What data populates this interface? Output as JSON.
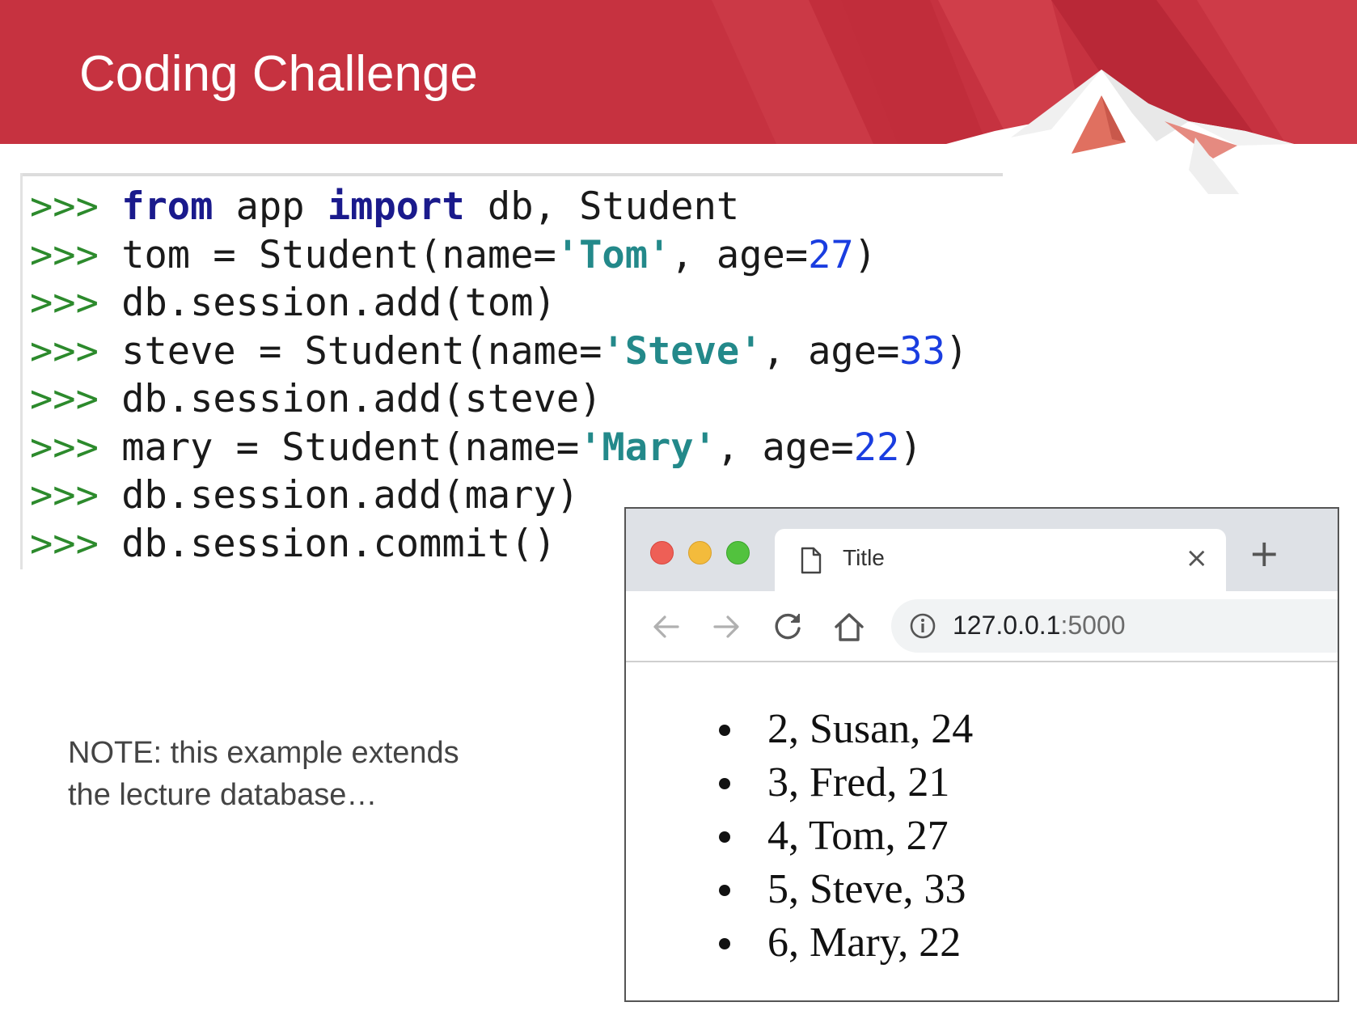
{
  "slide": {
    "title": "Coding Challenge",
    "colors": {
      "header_red": "#c63240",
      "header_dark": "#b0202e",
      "header_light": "#d4434f",
      "snow": "#ffffff"
    }
  },
  "code": {
    "prompt": ">>>",
    "lines": [
      {
        "segments": [
          {
            "t": "kw",
            "v": "from"
          },
          {
            "t": "plain",
            "v": " app "
          },
          {
            "t": "kw",
            "v": "import"
          },
          {
            "t": "plain",
            "v": " db, Student"
          }
        ]
      },
      {
        "segments": [
          {
            "t": "plain",
            "v": "tom = Student(name="
          },
          {
            "t": "str",
            "v": "'Tom'"
          },
          {
            "t": "plain",
            "v": ", age="
          },
          {
            "t": "num",
            "v": "27"
          },
          {
            "t": "plain",
            "v": ")"
          }
        ]
      },
      {
        "segments": [
          {
            "t": "plain",
            "v": "db.session.add(tom)"
          }
        ]
      },
      {
        "segments": [
          {
            "t": "plain",
            "v": "steve = Student(name="
          },
          {
            "t": "str",
            "v": "'Steve'"
          },
          {
            "t": "plain",
            "v": ", age="
          },
          {
            "t": "num",
            "v": "33"
          },
          {
            "t": "plain",
            "v": ")"
          }
        ]
      },
      {
        "segments": [
          {
            "t": "plain",
            "v": "db.session.add(steve)"
          }
        ]
      },
      {
        "segments": [
          {
            "t": "plain",
            "v": "mary = Student(name="
          },
          {
            "t": "str",
            "v": "'Mary'"
          },
          {
            "t": "plain",
            "v": ", age="
          },
          {
            "t": "num",
            "v": "22"
          },
          {
            "t": "plain",
            "v": ")"
          }
        ]
      },
      {
        "segments": [
          {
            "t": "plain",
            "v": "db.session.add(mary)"
          }
        ]
      },
      {
        "segments": [
          {
            "t": "plain",
            "v": "db.session.commit()"
          }
        ]
      }
    ]
  },
  "note": {
    "line1": "NOTE: this example extends",
    "line2": "the lecture database…"
  },
  "browser": {
    "tab": {
      "title": "Title",
      "icon": "document-icon",
      "close_symbol": "×"
    },
    "new_tab_symbol": "+",
    "nav_icons": [
      "back-arrow-icon",
      "forward-arrow-icon",
      "reload-icon",
      "home-icon"
    ],
    "address": {
      "host": "127.0.0.1",
      "port": ":5000",
      "icon": "info-icon"
    },
    "students": [
      "2, Susan, 24",
      "3, Fred, 21",
      "4, Tom, 27",
      "5, Steve, 33",
      "6, Mary, 22"
    ]
  }
}
